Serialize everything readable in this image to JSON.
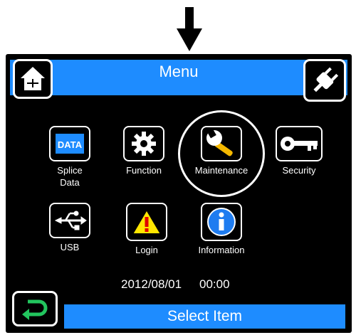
{
  "title": "Menu",
  "status": "Select Item",
  "date": "2012/08/01",
  "time": "00:00",
  "menu": {
    "splice_data": {
      "line1": "Splice",
      "line2": "Data",
      "icon_text": "DATA"
    },
    "function": {
      "label": "Function"
    },
    "maintenance": {
      "label": "Maintenance"
    },
    "security": {
      "label": "Security"
    },
    "usb": {
      "label": "USB"
    },
    "login": {
      "label": "Login"
    },
    "information": {
      "label": "Information"
    }
  },
  "icons": {
    "home": "home-icon",
    "plug": "plug-icon",
    "back": "back-icon",
    "arrow": "down-arrow-icon"
  },
  "colors": {
    "bar_blue": "#1e8cff",
    "screen_bg": "#000000",
    "wrench_yellow": "#f5b800",
    "warning_yellow": "#ffe600",
    "info_blue": "#1e7cf0",
    "back_green": "#22c55e"
  }
}
